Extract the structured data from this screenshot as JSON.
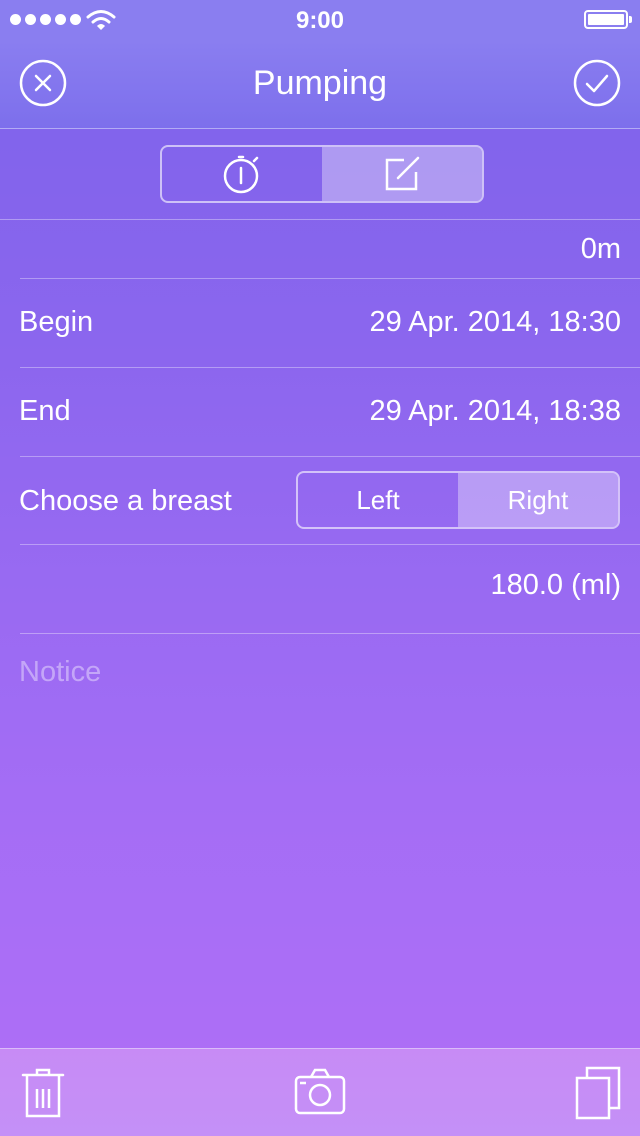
{
  "status_bar": {
    "time": "9:00",
    "icons": [
      "signal-dots-icon",
      "wifi-icon",
      "battery-icon"
    ]
  },
  "nav": {
    "title": "Pumping",
    "left_icon": "close-circle-icon",
    "right_icon": "checkmark-circle-icon"
  },
  "mode_segment": {
    "items": [
      {
        "icon": "stopwatch-icon",
        "selected": false
      },
      {
        "icon": "edit-icon",
        "selected": true
      }
    ]
  },
  "duration": "0m",
  "begin": {
    "label": "Begin",
    "value": "29 Apr. 2014, 18:30"
  },
  "end": {
    "label": "End",
    "value": "29 Apr. 2014, 18:38"
  },
  "breast": {
    "label": "Choose a breast",
    "options": [
      "Left",
      "Right"
    ],
    "selected": "Right"
  },
  "volume": "180.0 (ml)",
  "notice": {
    "placeholder": "Notice",
    "value": ""
  },
  "toolbar": {
    "icons": [
      "trash-icon",
      "camera-icon",
      "copy-icon"
    ]
  },
  "colors": {
    "gradient_top": "#7c62ea",
    "gradient_bottom": "#b06ff7",
    "navbar": "#8a7ef0",
    "toolbar": "#c78bf5"
  }
}
